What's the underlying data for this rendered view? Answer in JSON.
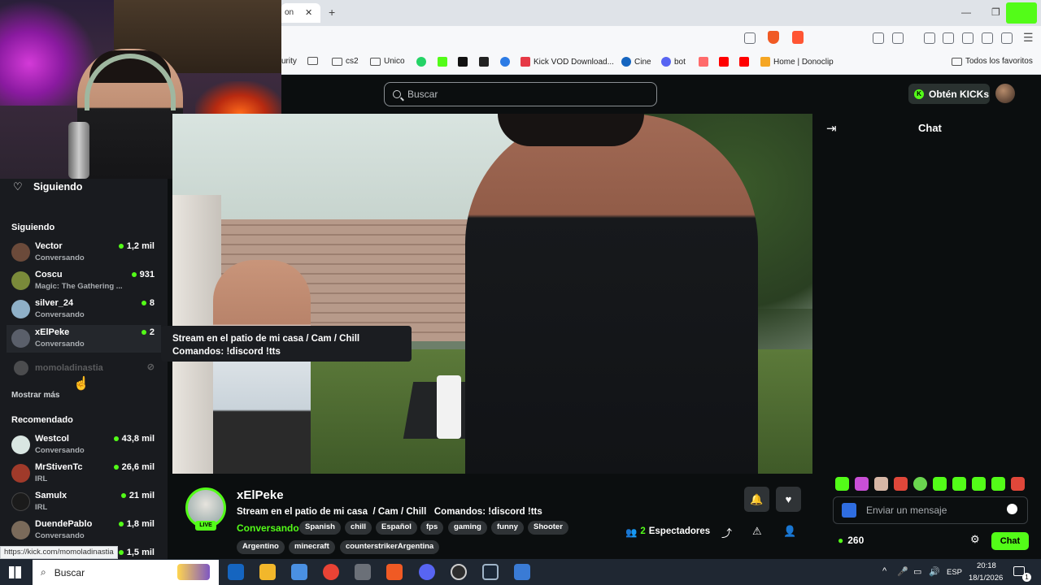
{
  "browser": {
    "tab_fragment": "on",
    "new_tab_symbol": "+",
    "window_controls": [
      "—",
      "❐"
    ],
    "bookmarks": [
      {
        "label": "urity",
        "icon": "lock-icon"
      },
      {
        "label": "",
        "icon": "folder-icon"
      },
      {
        "label": "cs2",
        "icon": "folder-icon"
      },
      {
        "label": "Unico",
        "icon": "folder-icon"
      },
      {
        "label": "",
        "icon": "whatsapp-icon"
      },
      {
        "label": "",
        "icon": "kick-icon"
      },
      {
        "label": "",
        "icon": "tiktok-icon"
      },
      {
        "label": "",
        "icon": "app-icon"
      },
      {
        "label": "",
        "icon": "edge-icon"
      },
      {
        "label": "Kick VOD Download...",
        "icon": "kick-vod-icon"
      },
      {
        "label": "Cine",
        "icon": "cine-icon"
      },
      {
        "label": "bot",
        "icon": "discord-icon"
      },
      {
        "label": "",
        "icon": "bars-icon"
      },
      {
        "label": "",
        "icon": "youtube-icon"
      },
      {
        "label": "",
        "icon": "youtube-icon"
      },
      {
        "label": "Home | Donoclip",
        "icon": "donoclip-icon"
      }
    ],
    "all_bookmarks_label": "Todos los favoritos",
    "status_url": "https://kick.com/momoladinastia"
  },
  "kick": {
    "search_placeholder": "Buscar",
    "get_kicks_label": "Obtén KICKs",
    "k_letter": "K"
  },
  "sidebar": {
    "title": "Siguiendo",
    "following_header": "Siguiendo",
    "following": [
      {
        "name": "Vector",
        "category": "Conversando",
        "viewers": "1,2 mil",
        "color": "#6b4a3a"
      },
      {
        "name": "Coscu",
        "category": "Magic: The Gathering ...",
        "viewers": "931",
        "color": "#7a8a3a"
      },
      {
        "name": "silver_24",
        "category": "Conversando",
        "viewers": "8",
        "color": "#8fb0c8"
      },
      {
        "name": "xElPeke",
        "category": "Conversando",
        "viewers": "2",
        "color": "#5a5f6a"
      }
    ],
    "offline_channel": "momoladinastia",
    "show_more": "Mostrar más",
    "recommended_header": "Recomendado",
    "recommended": [
      {
        "name": "Westcol",
        "category": "Conversando",
        "viewers": "43,8 mil",
        "color": "#d9e6e2"
      },
      {
        "name": "MrStivenTc",
        "category": "IRL",
        "viewers": "26,6 mil",
        "color": "#a03a2a"
      },
      {
        "name": "Samulx",
        "category": "IRL",
        "viewers": "21 mil",
        "color": "#1b1b1b"
      },
      {
        "name": "DuendePablo",
        "category": "Conversando",
        "viewers": "1,8 mil",
        "color": "#7a6a5a"
      }
    ],
    "partial_viewers": "1,5 mil"
  },
  "tooltip": {
    "line1": "Stream en el patio de mi casa / Cam / Chill",
    "line2": "Comandos: !discord !tts"
  },
  "stream": {
    "streamer": "xElPeke",
    "live_label": "LIVE",
    "title": "Stream en el patio de mi casa  / Cam / Chill   Comandos: !discord !tts",
    "category": "Conversando",
    "tags_row1": [
      "Spanish",
      "chill",
      "Español",
      "fps",
      "gaming",
      "funny",
      "Shooter"
    ],
    "tags_row2": [
      "Argentino",
      "minecraft",
      "counterstrikerArgentina"
    ],
    "viewers_count": "2",
    "viewers_label": "Espectadores"
  },
  "chat": {
    "title": "Chat",
    "placeholder": "Enviar un mensaje",
    "kicks_balance": "260",
    "send_label": "Chat",
    "emote_colors": [
      "#53fc18",
      "#c94fd6",
      "#d7b7a6",
      "#e0473a",
      "#6ad64f",
      "#53fc18",
      "#53fc18",
      "#53fc18",
      "#53fc18",
      "#e0473a"
    ]
  },
  "taskbar": {
    "search_label": "Buscar",
    "language": "ESP",
    "time": "20:18",
    "date": "18/1/2026",
    "notification_count": "1"
  }
}
